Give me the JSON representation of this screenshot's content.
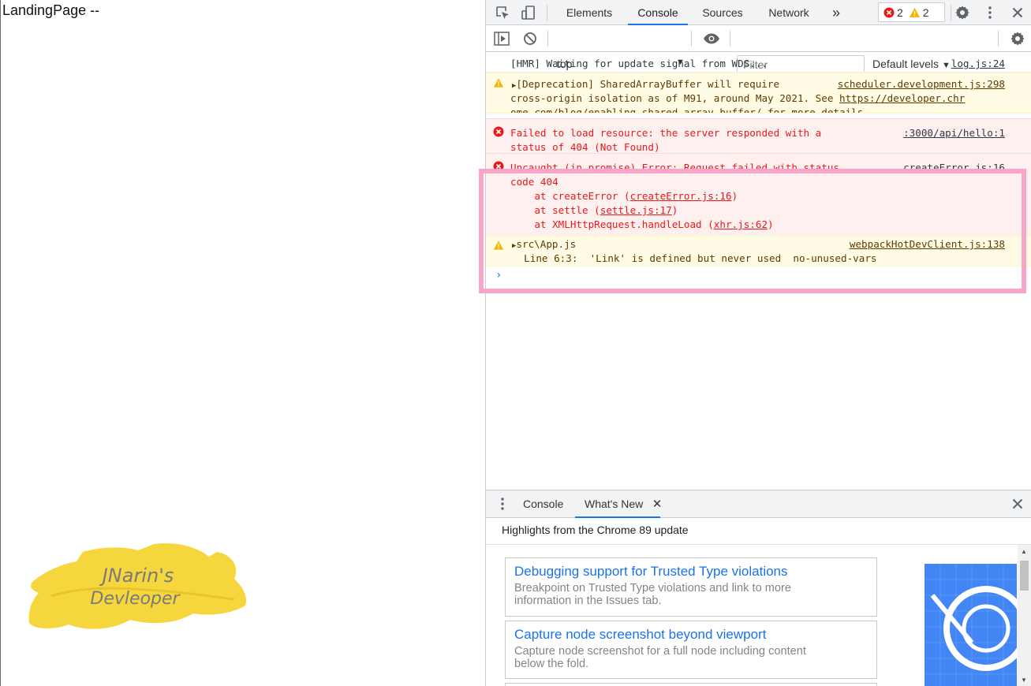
{
  "page": {
    "text": "LandingPage --",
    "logo": {
      "line1": "JNarin's",
      "line2": "Devleoper"
    }
  },
  "devtools": {
    "tabs": [
      "Elements",
      "Console",
      "Sources",
      "Network"
    ],
    "active_tab": "Console",
    "more_tabs_icon": "chevron-double-right-icon",
    "error_count": "2",
    "warning_count": "2",
    "context": "top",
    "filter_placeholder": "Filter",
    "levels": "Default levels",
    "colors": {
      "error": "#e61a1a",
      "warning": "#f5b400",
      "accent": "#1a73e8",
      "highlight": "#f7a6c9"
    }
  },
  "console": {
    "messages": [
      {
        "type": "log",
        "lines": [
          "[HMR] Waiting for update signal from WDS..."
        ],
        "source": "log.js:24"
      },
      {
        "type": "warning",
        "lines": [
          "[Deprecation] SharedArrayBuffer will require",
          "cross-origin isolation as of M91, around May 2021. See ",
          "ome.com/blog/enabling-shared-array-buffer/ for more details."
        ],
        "link": "https://developer.chr",
        "source": "scheduler.development.js:298"
      },
      {
        "type": "error",
        "lines": [
          "Failed to load resource: the server responded with a",
          "status of 404 (Not Found)"
        ],
        "source": ":3000/api/hello:1"
      },
      {
        "type": "error",
        "lines": [
          "Uncaught (in promise) Error: Request failed with status",
          "code 404"
        ],
        "stack": [
          {
            "prefix": "    at createError (",
            "link": "createError.js:16",
            "suffix": ")"
          },
          {
            "prefix": "    at settle (",
            "link": "settle.js:17",
            "suffix": ")"
          },
          {
            "prefix": "    at XMLHttpRequest.handleLoad (",
            "link": "xhr.js:62",
            "suffix": ")"
          }
        ],
        "source": "createError.js:16"
      },
      {
        "type": "warning",
        "lines": [
          "src\\App.js",
          "  Line 6:3:  'Link' is defined but never used  no-unused-vars"
        ],
        "source": "webpackHotDevClient.js:138"
      }
    ],
    "prompt": "›"
  },
  "drawer": {
    "tabs": [
      "Console",
      "What's New"
    ],
    "active_tab": "What's New",
    "heading": "Highlights from the Chrome 89 update",
    "cards": [
      {
        "title": "Debugging support for Trusted Type violations",
        "desc_1": "Breakpoint on Trusted Type violations and link to more",
        "desc_2": "information in the Issues tab."
      },
      {
        "title": "Capture node screenshot beyond viewport",
        "desc_1": "Capture node screenshot for a full node including content",
        "desc_2": "below the fold."
      }
    ]
  }
}
